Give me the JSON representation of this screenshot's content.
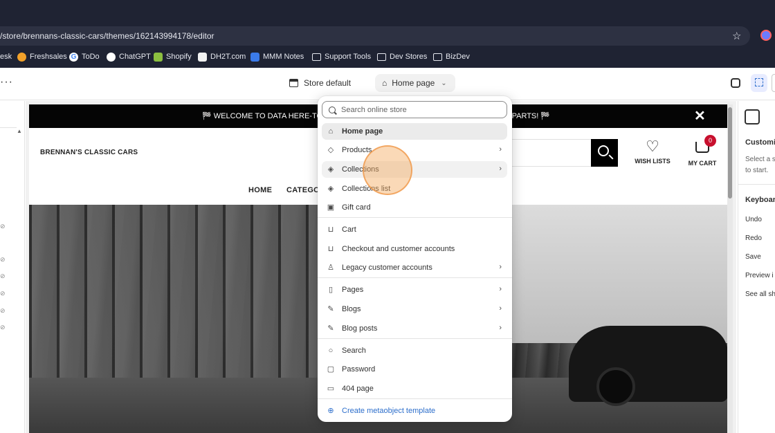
{
  "browser": {
    "url": "/store/brennans-classic-cars/themes/162143994178/editor",
    "bookmarks": [
      "esk",
      "Freshsales",
      "ToDo",
      "ChatGPT",
      "Shopify",
      "DH2T.com",
      "MMM Notes",
      "Support Tools",
      "Dev Stores",
      "BizDev"
    ]
  },
  "editor": {
    "more_label": "···",
    "store_label": "Store default",
    "page_label": "Home page"
  },
  "dropdown": {
    "search_placeholder": "Search online store",
    "items": [
      {
        "label": "Home page"
      },
      {
        "label": "Products"
      },
      {
        "label": "Collections"
      },
      {
        "label": "Collections list"
      },
      {
        "label": "Gift card"
      },
      {
        "label": "Cart"
      },
      {
        "label": "Checkout and customer accounts"
      },
      {
        "label": "Legacy customer accounts"
      },
      {
        "label": "Pages"
      },
      {
        "label": "Blogs"
      },
      {
        "label": "Blog posts"
      },
      {
        "label": "Search"
      },
      {
        "label": "Password"
      },
      {
        "label": "404 page"
      },
      {
        "label": "Create metaobject template"
      }
    ]
  },
  "preview": {
    "announcement_left": "🏁  WELCOME TO DATA HERE-TO-T",
    "announcement_right": "G PARTS!  🏁",
    "close_label": "✕",
    "brand": "BRENNAN'S CLASSIC CARS",
    "wish_label": "WISH LISTS",
    "cart_label": "MY CART",
    "cart_count": "0",
    "nav": [
      "HOME",
      "CATEGOR"
    ]
  },
  "right_panel": {
    "title": "Customiz",
    "desc_line1": "Select a s",
    "desc_line2": "to start.",
    "keyboard_title": "Keyboar",
    "shortcuts": [
      "Undo",
      "Redo",
      "Save",
      "Preview i",
      "See all sh"
    ]
  }
}
